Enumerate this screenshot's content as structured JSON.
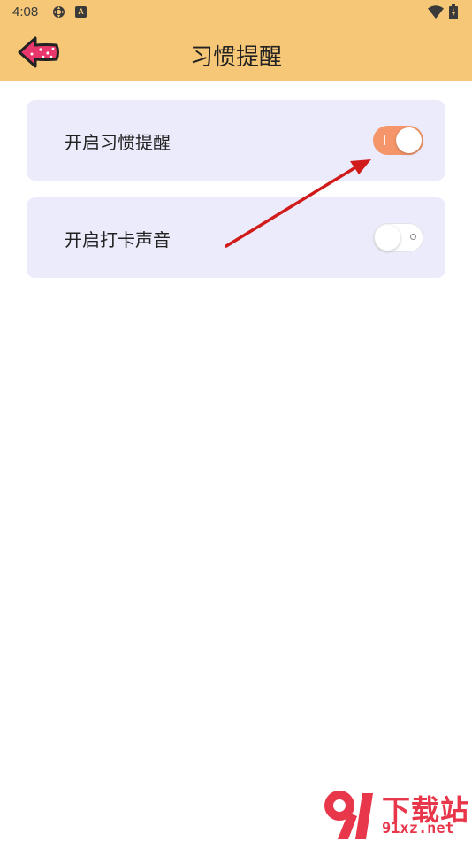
{
  "status_bar": {
    "time": "4:08",
    "icons": [
      "gear-icon",
      "a-badge-icon",
      "wifi-icon",
      "battery-icon"
    ]
  },
  "header": {
    "title": "习惯提醒",
    "back_icon": "back-arrow-icon",
    "background": "#f6c777"
  },
  "settings": [
    {
      "label": "开启习惯提醒",
      "enabled": true
    },
    {
      "label": "开启打卡声音",
      "enabled": false
    }
  ],
  "colors": {
    "card_background": "#ebebfc",
    "switch_on": "#f5966a",
    "annotation_arrow": "#d11a1a"
  },
  "watermark": {
    "logo": "91-logo",
    "brand": "下载站",
    "domain": "91xz.net"
  }
}
